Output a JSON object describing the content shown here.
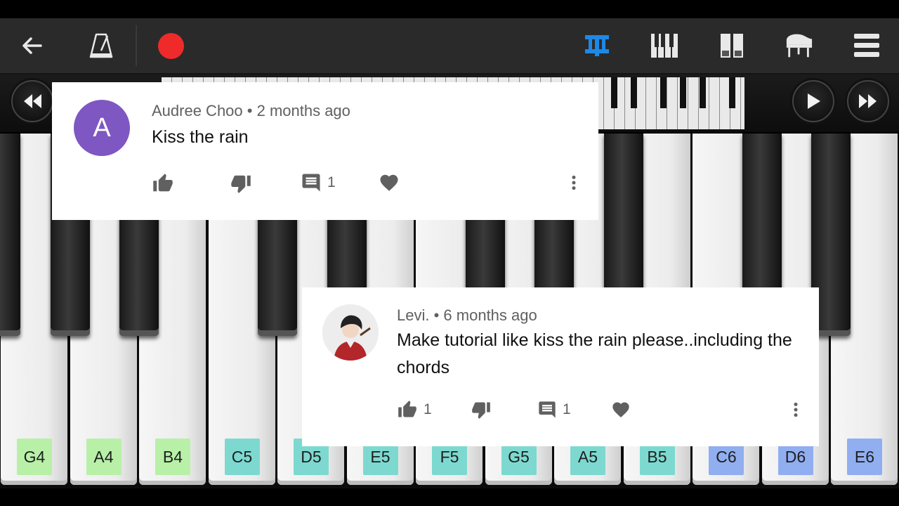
{
  "toolbar": {
    "icons": [
      "back-arrow-icon",
      "metronome-icon",
      "record-icon",
      "chord-mode-icon",
      "keyboard-icon",
      "dual-keyboard-icon",
      "grand-piano-icon",
      "menu-icon"
    ],
    "record_color": "#ef2a2a",
    "accent_color": "#1e88e5"
  },
  "strip": {
    "buttons": [
      "rewind-icon",
      "play-icon",
      "fast-forward-icon"
    ]
  },
  "piano": {
    "white_keys": [
      {
        "note": "G4",
        "color": "#b8f0a8"
      },
      {
        "note": "A4",
        "color": "#b8f0a8"
      },
      {
        "note": "B4",
        "color": "#b8f0a8"
      },
      {
        "note": "C5",
        "color": "#7dd9d0"
      },
      {
        "note": "D5",
        "color": "#7dd9d0"
      },
      {
        "note": "E5",
        "color": "#7dd9d0"
      },
      {
        "note": "F5",
        "color": "#7dd9d0"
      },
      {
        "note": "G5",
        "color": "#7dd9d0"
      },
      {
        "note": "A5",
        "color": "#7dd9d0"
      },
      {
        "note": "B5",
        "color": "#7dd9d0"
      },
      {
        "note": "C6",
        "color": "#90aef0"
      },
      {
        "note": "D6",
        "color": "#90aef0"
      },
      {
        "note": "E6",
        "color": "#90aef0"
      }
    ]
  },
  "comments": [
    {
      "avatar_letter": "A",
      "avatar_color": "#7e57c2",
      "author": "Audree Choo",
      "time": "2 months ago",
      "text": "Kiss the rain",
      "likes": "",
      "replies": "1"
    },
    {
      "avatar_letter": "",
      "avatar_color": "#d9d9d9",
      "author": "Levi.",
      "time": "6 months ago",
      "text": "Make tutorial like kiss the rain please..including the chords",
      "likes": "1",
      "replies": "1"
    }
  ],
  "separator": " • "
}
